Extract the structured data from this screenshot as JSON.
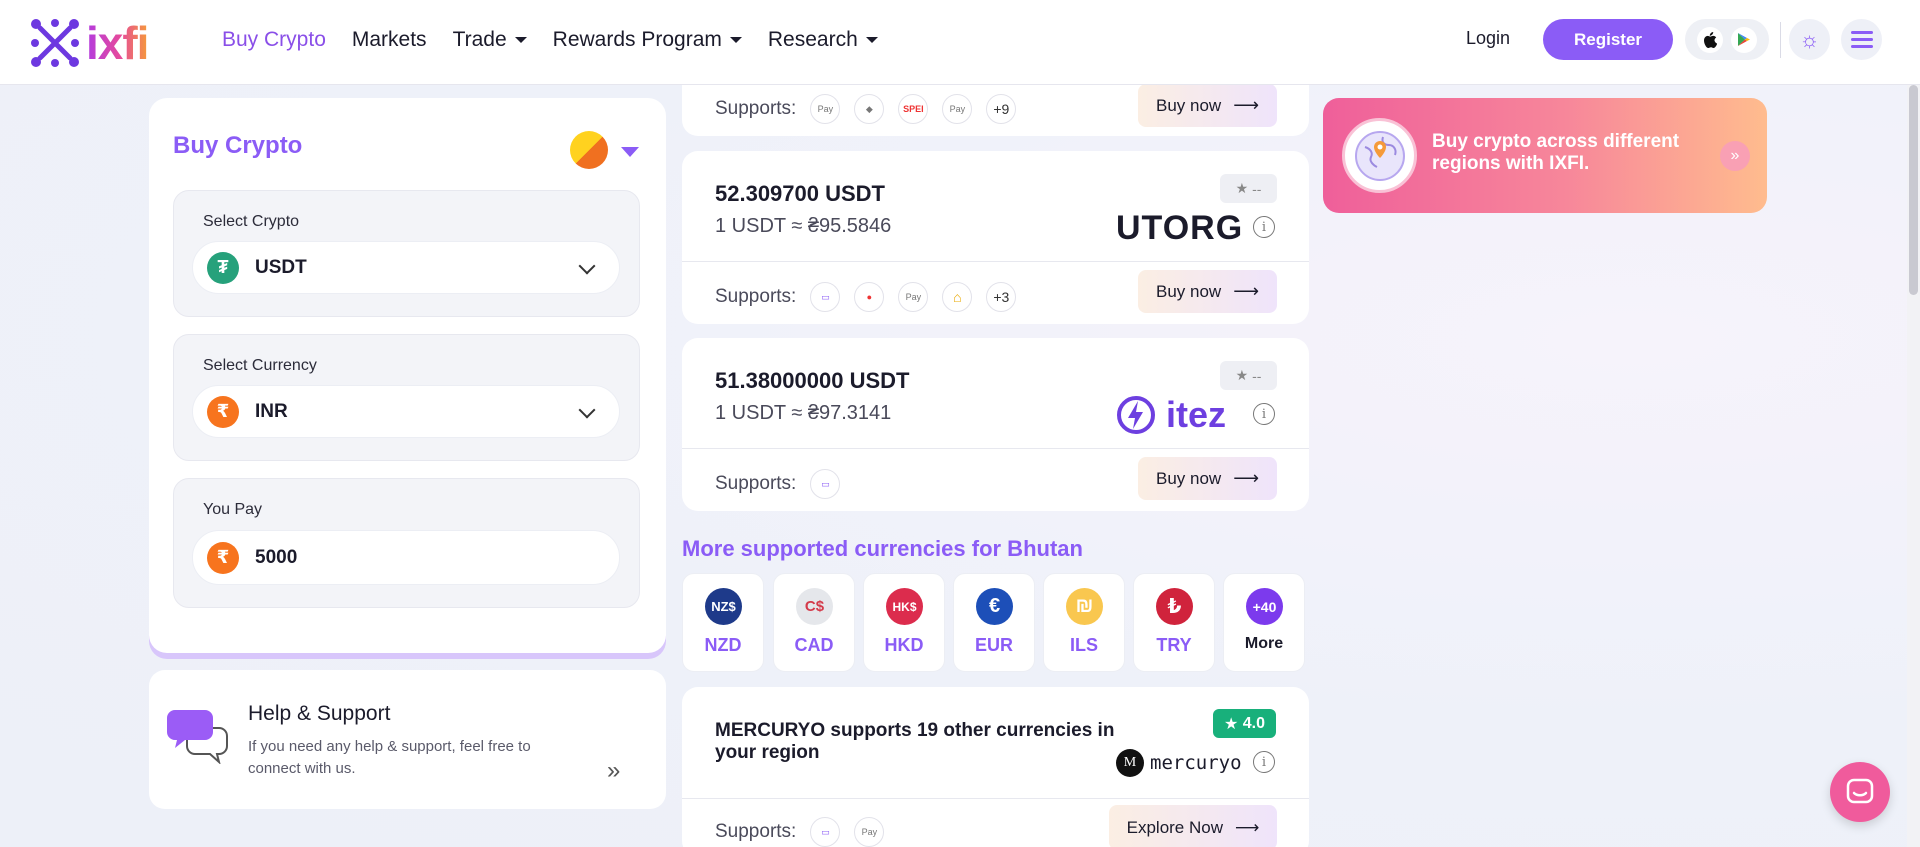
{
  "header": {
    "logo_text": "ixfi",
    "nav": [
      {
        "label": "Buy Crypto",
        "active": true,
        "dropdown": false
      },
      {
        "label": "Markets",
        "active": false,
        "dropdown": false
      },
      {
        "label": "Trade",
        "active": false,
        "dropdown": true
      },
      {
        "label": "Rewards Program",
        "active": false,
        "dropdown": true
      },
      {
        "label": "Research",
        "active": false,
        "dropdown": true
      }
    ],
    "login_label": "Login",
    "register_label": "Register"
  },
  "buy_panel": {
    "title": "Buy Crypto",
    "select_crypto_label": "Select Crypto",
    "crypto_value": "USDT",
    "select_currency_label": "Select Currency",
    "currency_value": "INR",
    "you_pay_label": "You Pay",
    "pay_value": "5000",
    "currency_symbol": "₹"
  },
  "help": {
    "title": "Help & Support",
    "text": "If you need any help & support, feel free to connect with us."
  },
  "providers": [
    {
      "supports_label": "Supports:",
      "methods": [
        "PayPal",
        "card",
        "SPEI",
        "Apple Pay"
      ],
      "more": "+9",
      "buy_label": "Buy now"
    },
    {
      "amount": "52.309700 USDT",
      "rate": "1 USDT ≈ ₴95.5846",
      "rating": "--",
      "provider_name": "UTORG",
      "supports_label": "Supports:",
      "methods": [
        "card",
        "Mastercard",
        "Apple Pay",
        "bank"
      ],
      "more": "+3",
      "buy_label": "Buy now"
    },
    {
      "amount": "51.38000000 USDT",
      "rate": "1 USDT ≈ ₴97.3141",
      "rating": "--",
      "provider_name": "itez",
      "supports_label": "Supports:",
      "methods": [
        "card"
      ],
      "buy_label": "Buy now"
    }
  ],
  "more_currencies": {
    "title": "More supported currencies for Bhutan",
    "items": [
      {
        "code": "NZD",
        "icon": "NZ$",
        "color": "#1e3a8a"
      },
      {
        "code": "CAD",
        "icon": "C$",
        "color": "#e5e7eb"
      },
      {
        "code": "HKD",
        "icon": "HK$",
        "color": "#dc2c4d"
      },
      {
        "code": "EUR",
        "icon": "€",
        "color": "#1d4fb8"
      },
      {
        "code": "ILS",
        "icon": "₪",
        "color": "#f9c74f"
      },
      {
        "code": "TRY",
        "icon": "₺",
        "color": "#d0233c"
      }
    ],
    "more_count": "+40",
    "more_label": "More"
  },
  "mercuryo": {
    "text": "MERCURYO supports 19 other currencies in your region",
    "rating": "4.0",
    "provider_name": "mercuryo",
    "supports_label": "Supports:",
    "methods": [
      "card",
      "Apple Pay"
    ],
    "explore_label": "Explore Now"
  },
  "banner": {
    "text": "Buy crypto across different regions with IXFI."
  },
  "colors": {
    "accent": "#8b5cf6",
    "rating_green": "#18b07b",
    "banner_start": "#ef5f9a",
    "banner_end": "#ffbc8e"
  }
}
